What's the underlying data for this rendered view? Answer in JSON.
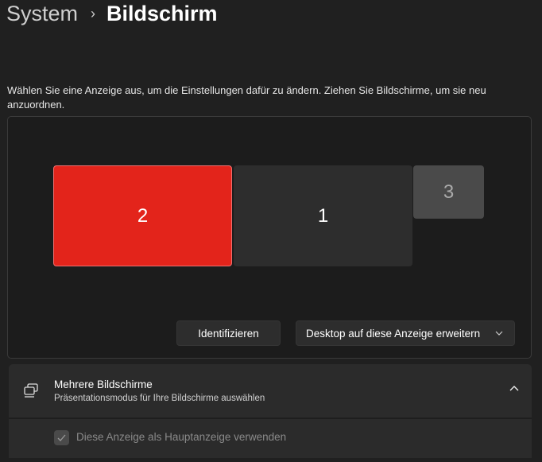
{
  "breadcrumb": {
    "parent": "System",
    "separator": "›",
    "current": "Bildschirm"
  },
  "description": "Wählen Sie eine Anzeige aus, um die Einstellungen dafür zu ändern. Ziehen Sie Bildschirme, um sie neu anzuordnen.",
  "monitors": [
    {
      "label": "2",
      "selected": true
    },
    {
      "label": "1"
    },
    {
      "label": "3"
    }
  ],
  "identify_label": "Identifizieren",
  "mode_dropdown": {
    "value": "Desktop auf diese Anzeige erweitern"
  },
  "multiple_displays": {
    "title": "Mehrere Bildschirme",
    "subtitle": "Präsentationsmodus für Ihre Bildschirme auswählen",
    "expanded": true,
    "primary_checkbox": {
      "label": "Diese Anzeige als Hauptanzeige verwenden",
      "checked": true,
      "disabled": true
    }
  },
  "colors": {
    "accent": "#e3241b",
    "background": "#202020",
    "card": "#2b2b2b"
  }
}
